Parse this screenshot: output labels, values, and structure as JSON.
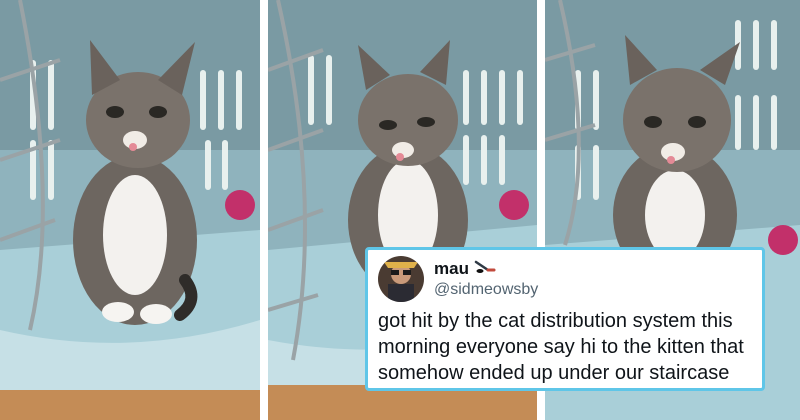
{
  "panels": [
    {
      "subject": "tabby kitten sitting in open blue pet carrier, tongue out, looking at camera"
    },
    {
      "subject": "tabby kitten in pet carrier looking down to the side, tongue out"
    },
    {
      "subject": "tabby kitten in pet carrier looking at camera with tongue out"
    }
  ],
  "tweet": {
    "display_name": "mau",
    "emoji_icon": "hockey-stick-puck-icon",
    "handle": "@sidmeowsby",
    "text": "got hit by the cat distribution system this morning everyone say hi to the kitten that somehow ended up under our staircase",
    "border_color": "#5fc6e8"
  },
  "colors": {
    "carrier_blue": "#a9cfd8",
    "carrier_shadow": "#6e8f98",
    "floor_wood": "#c48c56",
    "ball_pink": "#c2306a"
  }
}
